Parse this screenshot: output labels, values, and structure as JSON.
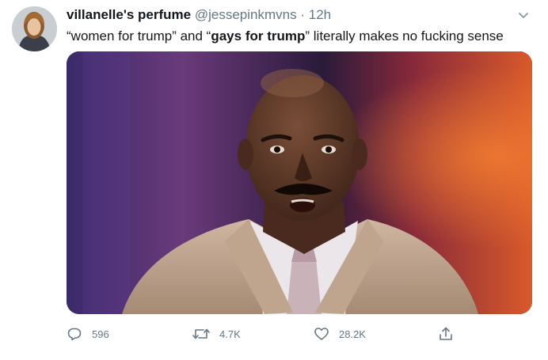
{
  "tweet": {
    "author_name": "villanelle's perfume",
    "handle": "@jessepinkmvns",
    "separator": "·",
    "time": "12h",
    "text_part1": "“women for trump” and “",
    "text_bold": "gays for trump",
    "text_part2": "” literally makes no fucking sense",
    "avatar_icon": "profile-avatar",
    "more_icon": "chevron-down-icon",
    "media": {
      "type": "image",
      "description_icon": "photo-media"
    }
  },
  "actions": {
    "reply": {
      "icon": "reply-icon",
      "count": "596"
    },
    "retweet": {
      "icon": "retweet-icon",
      "count": "4.7K"
    },
    "like": {
      "icon": "like-icon",
      "count": "28.2K"
    },
    "share": {
      "icon": "share-icon"
    }
  },
  "colors": {
    "text": "#14171a",
    "secondary": "#657786",
    "background": "#ffffff"
  }
}
